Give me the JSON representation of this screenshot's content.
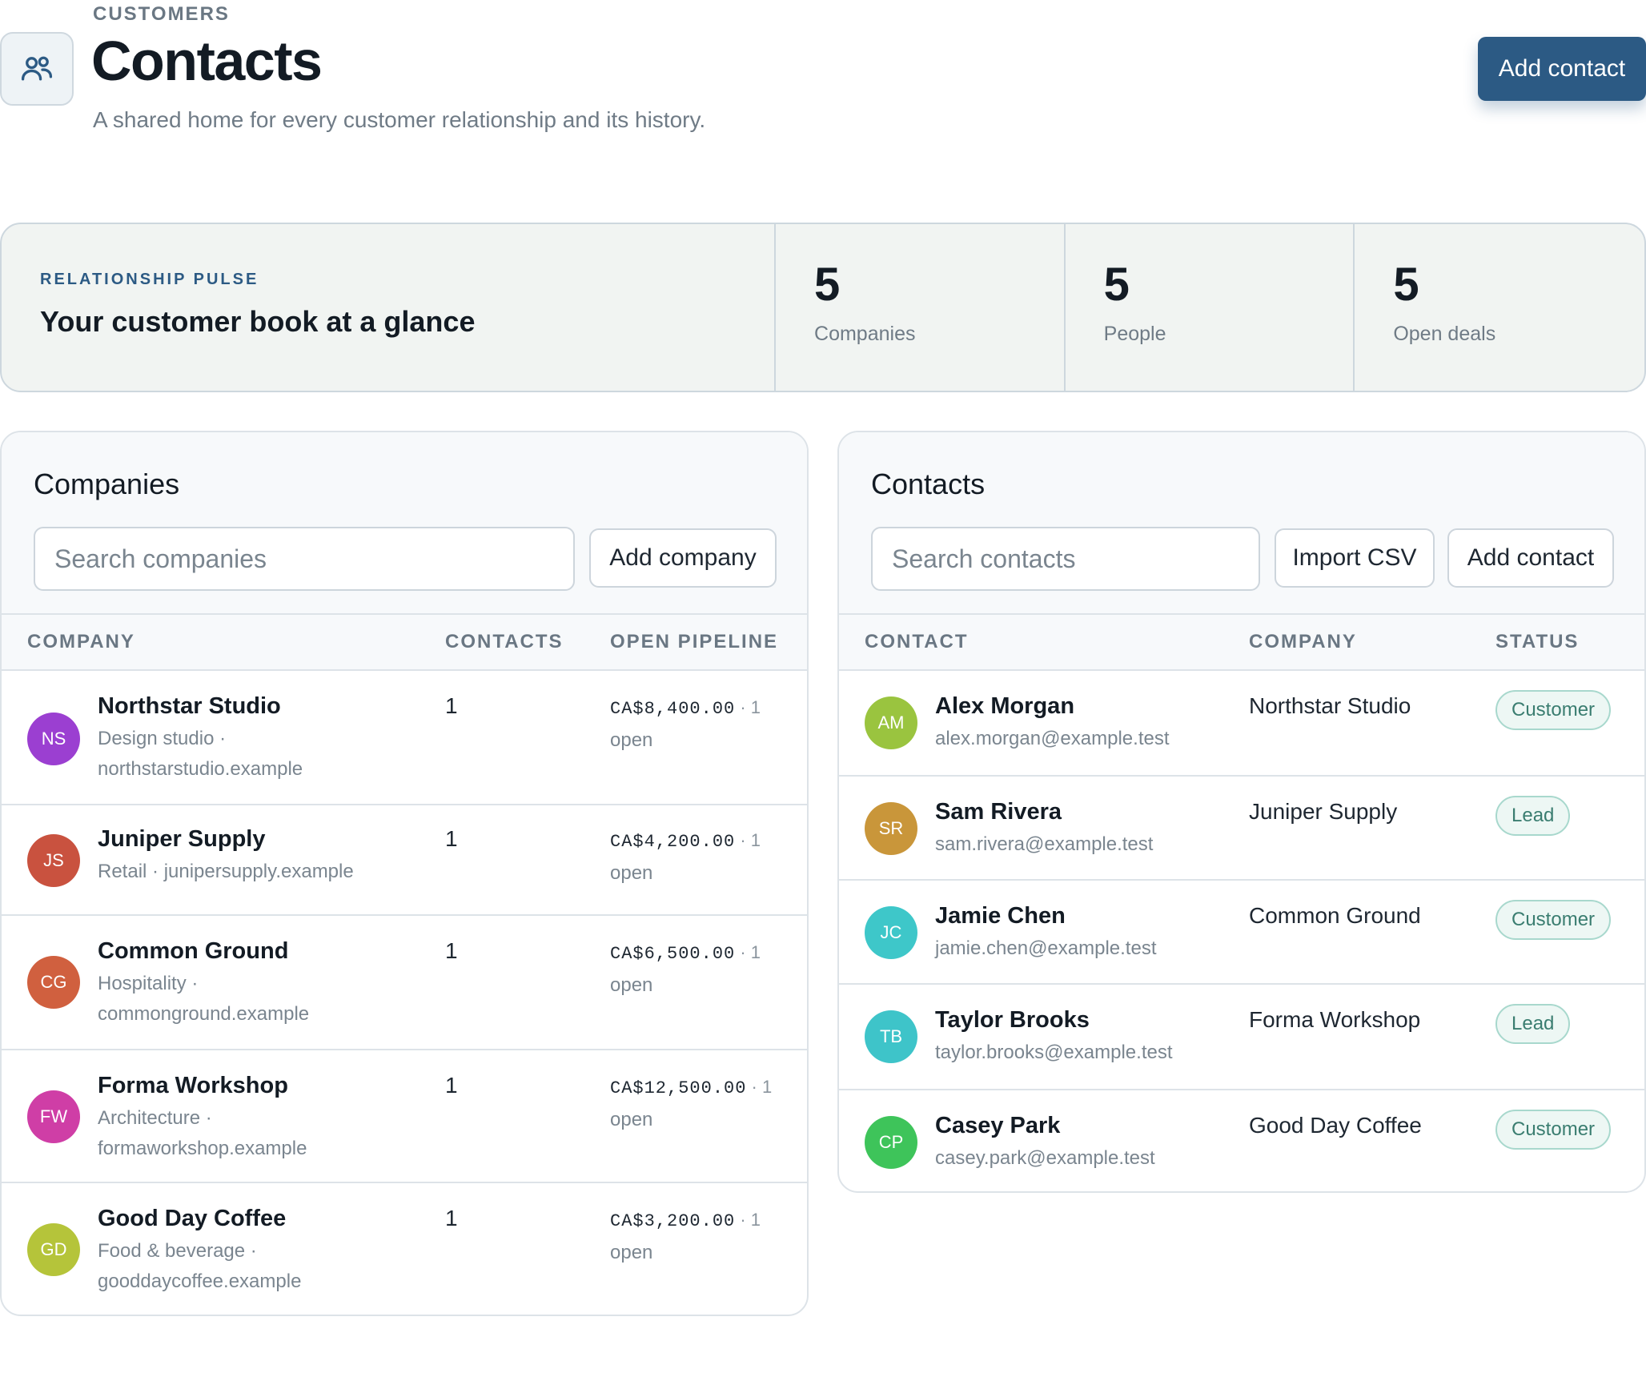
{
  "header": {
    "eyebrow": "CUSTOMERS",
    "title": "Contacts",
    "subtitle": "A shared home for every customer relationship and its history.",
    "add_contact_label": "Add contact",
    "icon": "people-icon"
  },
  "pulse": {
    "eyebrow": "RELATIONSHIP PULSE",
    "title": "Your customer book at a glance",
    "stats": [
      {
        "value": "5",
        "label": "Companies"
      },
      {
        "value": "5",
        "label": "People"
      },
      {
        "value": "5",
        "label": "Open deals"
      }
    ]
  },
  "companies": {
    "title": "Companies",
    "search_placeholder": "Search companies",
    "add_label": "Add company",
    "columns": [
      "COMPANY",
      "CONTACTS",
      "OPEN PIPELINE"
    ],
    "rows": [
      {
        "initials": "NS",
        "color": "#9b3fd1",
        "name": "Northstar Studio",
        "meta1": "Design studio ·",
        "meta2": "northstarstudio.example",
        "contacts": "1",
        "amount": "CA$8,400.00",
        "deals_tail": " · 1",
        "open": "open"
      },
      {
        "initials": "JS",
        "color": "#c9523f",
        "name": "Juniper Supply",
        "meta1": "Retail · junipersupply.example",
        "meta2": "",
        "contacts": "1",
        "amount": "CA$4,200.00",
        "deals_tail": " · 1",
        "open": "open"
      },
      {
        "initials": "CG",
        "color": "#d0603f",
        "name": "Common Ground",
        "meta1": "Hospitality ·",
        "meta2": "commonground.example",
        "contacts": "1",
        "amount": "CA$6,500.00",
        "deals_tail": " · 1",
        "open": "open"
      },
      {
        "initials": "FW",
        "color": "#cf3ea6",
        "name": "Forma Workshop",
        "meta1": "Architecture ·",
        "meta2": "formaworkshop.example",
        "contacts": "1",
        "amount": "CA$12,500.00",
        "deals_tail": " · 1",
        "open": "open"
      },
      {
        "initials": "GD",
        "color": "#b5c43a",
        "name": "Good Day Coffee",
        "meta1": "Food & beverage ·",
        "meta2": "gooddaycoffee.example",
        "contacts": "1",
        "amount": "CA$3,200.00",
        "deals_tail": " · 1",
        "open": "open"
      }
    ]
  },
  "contacts": {
    "title": "Contacts",
    "search_placeholder": "Search contacts",
    "import_label": "Import CSV",
    "add_label": "Add contact",
    "columns": [
      "CONTACT",
      "COMPANY",
      "STATUS"
    ],
    "rows": [
      {
        "initials": "AM",
        "color": "#9ac43f",
        "name": "Alex Morgan",
        "email": "alex.morgan@example.test",
        "company": "Northstar Studio",
        "status": "Customer"
      },
      {
        "initials": "SR",
        "color": "#c9963a",
        "name": "Sam Rivera",
        "email": "sam.rivera@example.test",
        "company": "Juniper Supply",
        "status": "Lead"
      },
      {
        "initials": "JC",
        "color": "#3ec7c9",
        "name": "Jamie Chen",
        "email": "jamie.chen@example.test",
        "company": "Common Ground",
        "status": "Customer"
      },
      {
        "initials": "TB",
        "color": "#3ec4c9",
        "name": "Taylor Brooks",
        "email": "taylor.brooks@example.test",
        "company": "Forma Workshop",
        "status": "Lead"
      },
      {
        "initials": "CP",
        "color": "#3ec45a",
        "name": "Casey Park",
        "email": "casey.park@example.test",
        "company": "Good Day Coffee",
        "status": "Customer"
      }
    ]
  }
}
